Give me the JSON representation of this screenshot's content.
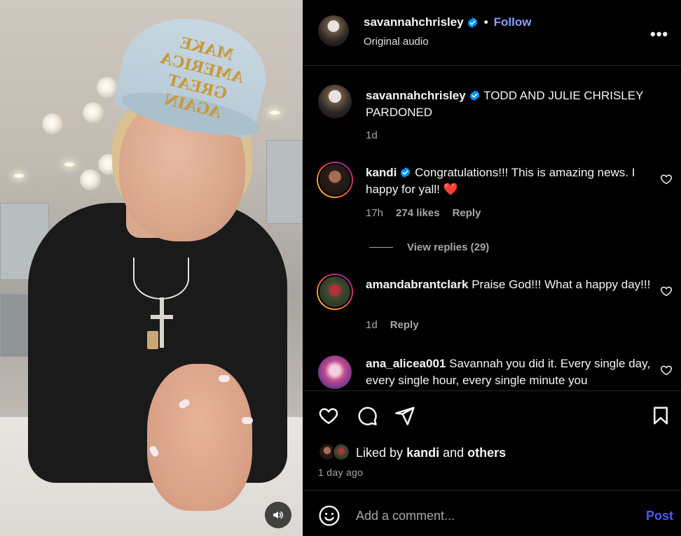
{
  "post": {
    "author": "savannahchrisley",
    "follow_label": "Follow",
    "separator": "•",
    "audio": "Original audio",
    "more": "•••"
  },
  "cap_text": "MAKE AMERICA GREAT AGAIN",
  "comments": [
    {
      "username": "savannahchrisley",
      "verified": true,
      "text": "TODD AND JULIE CHRISLEY PARDONED",
      "time": "1d"
    },
    {
      "username": "kandi",
      "verified": true,
      "text": "Congratulations!!! This is amazing news. I happy for yall! ❤️",
      "time": "17h",
      "likes": "274 likes",
      "reply": "Reply",
      "view_replies": "View replies (29)"
    },
    {
      "username": "amandabrantclark",
      "verified": false,
      "text": "Praise God!!! What a happy day!!!",
      "time": "1d",
      "reply": "Reply"
    },
    {
      "username": "ana_alicea001",
      "verified": false,
      "text": "Savannah you did it. Every single day, every single hour, every single minute you"
    }
  ],
  "likes": {
    "prefix": "Liked by",
    "user": "kandi",
    "conjunction": "and",
    "others": "others"
  },
  "time_ago": "1 day ago",
  "comment_box": {
    "placeholder": "Add a comment...",
    "post_label": "Post"
  },
  "colors": {
    "accent_link": "#85a1ff",
    "post_blue": "#4a5df9",
    "verified_blue": "#0095f6",
    "heart_red": "#ff3040"
  }
}
